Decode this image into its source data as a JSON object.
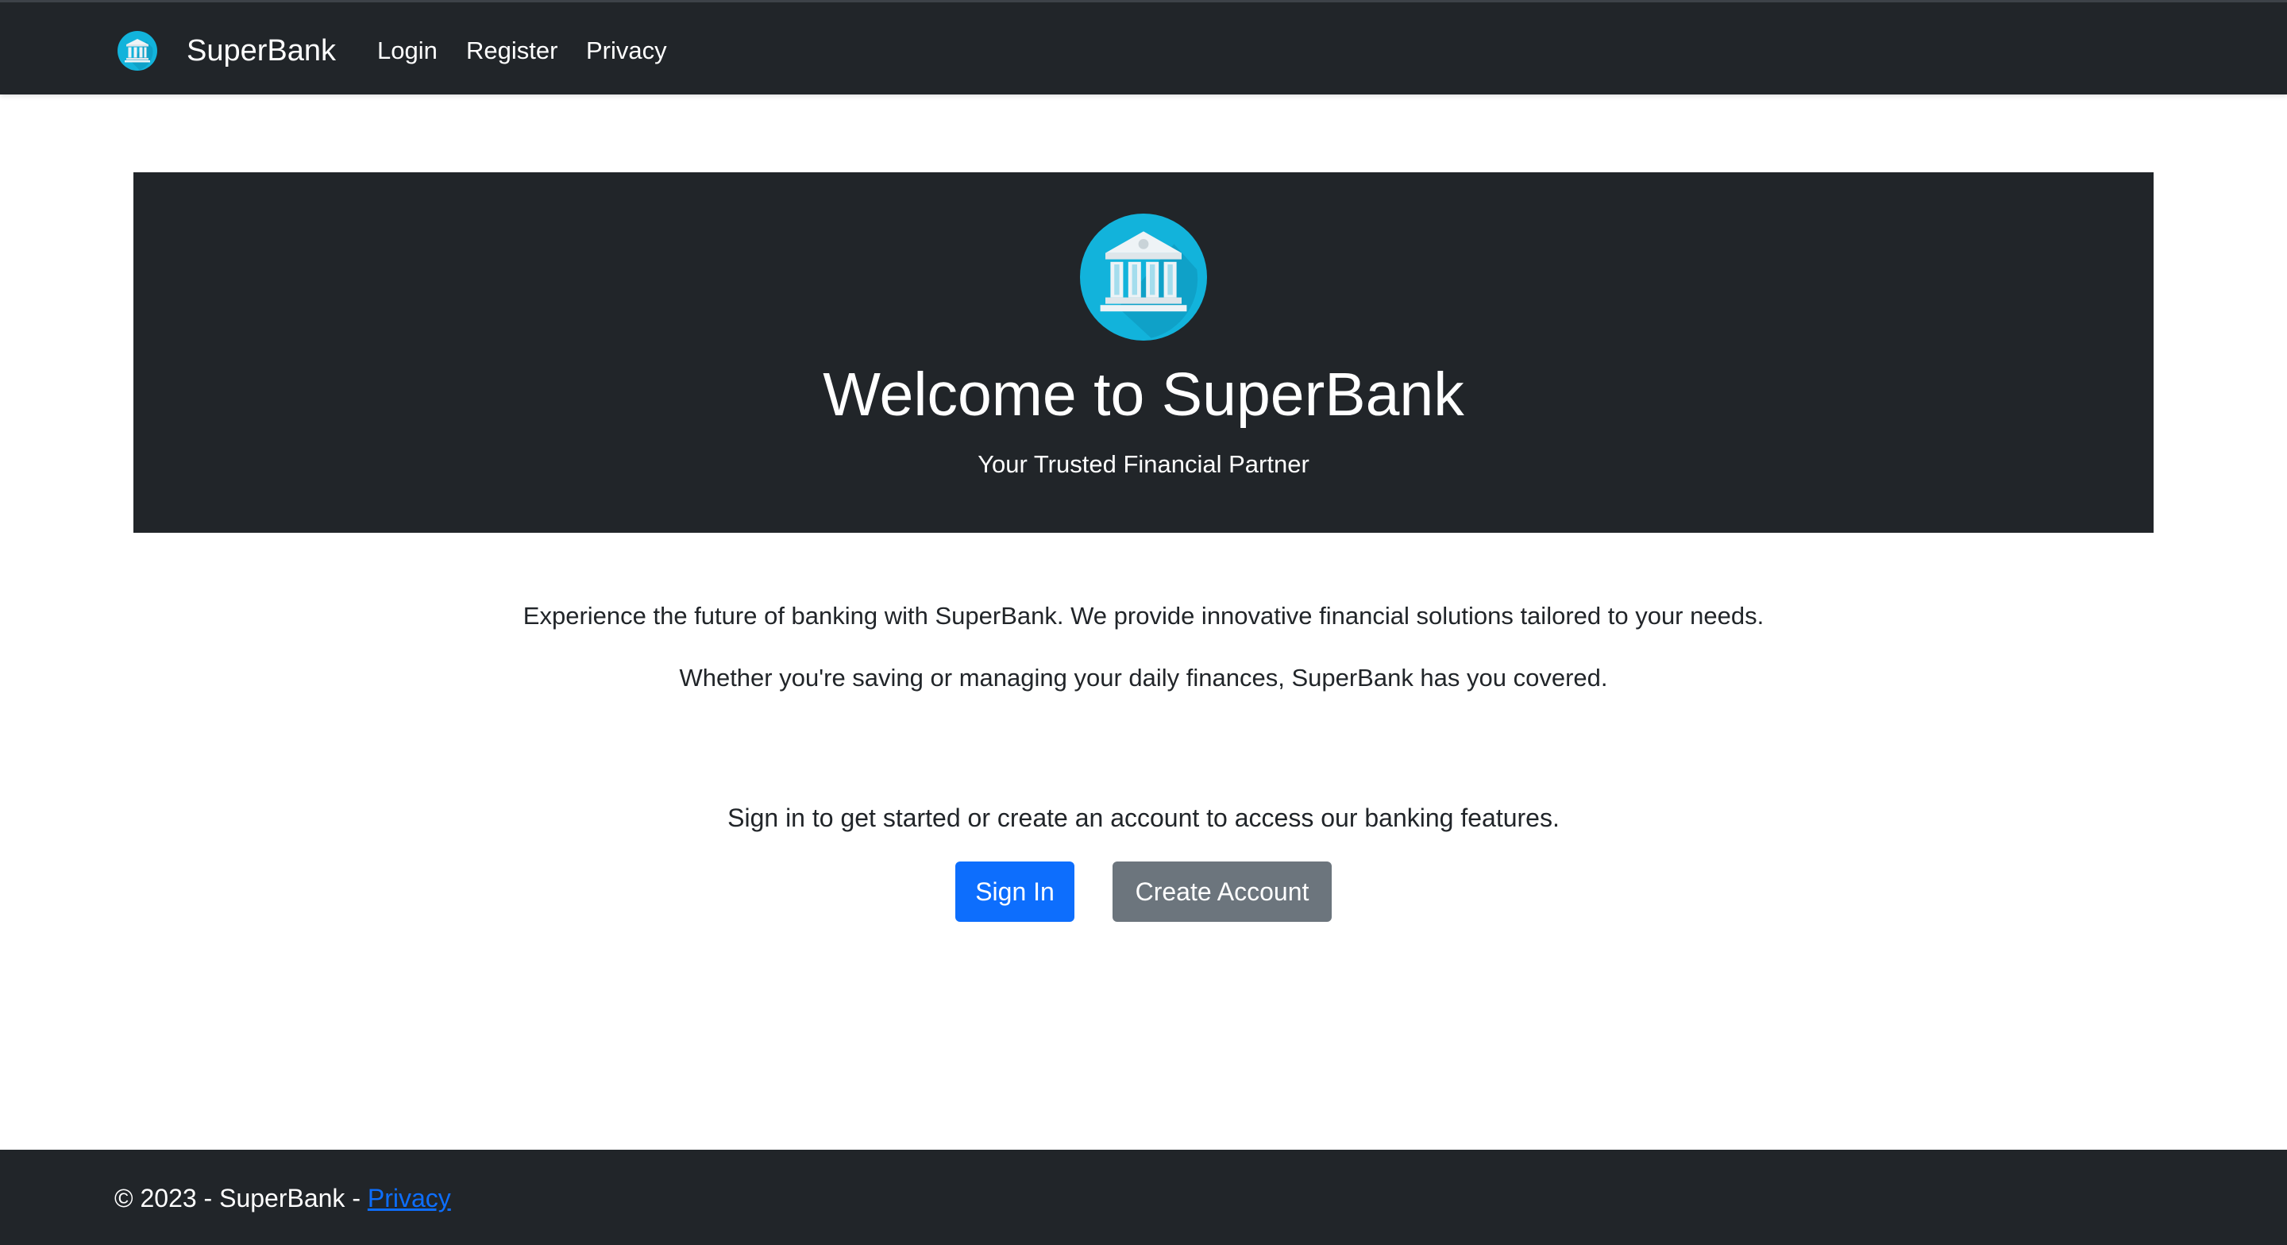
{
  "navbar": {
    "brand": "SuperBank",
    "brand_icon": "bank-building-icon",
    "links": {
      "login": "Login",
      "register": "Register",
      "privacy": "Privacy"
    }
  },
  "hero": {
    "icon": "bank-building-icon",
    "title": "Welcome to SuperBank",
    "subtitle": "Your Trusted Financial Partner"
  },
  "content": {
    "paragraph_1": "Experience the future of banking with SuperBank. We provide innovative financial solutions tailored to your needs.",
    "paragraph_2": "Whether you're saving or managing your daily finances, SuperBank has you covered.",
    "cta_text": "Sign in to get started or create an account to access our banking features.",
    "sign_in_label": "Sign In",
    "create_account_label": "Create Account"
  },
  "footer": {
    "text": "© 2023 - SuperBank - ",
    "privacy_label": "Privacy"
  },
  "colors": {
    "dark": "#212529",
    "primary": "#0d6efd",
    "secondary": "#6c757d",
    "icon_circle": "#1bb4dc",
    "icon_building": "#e8eef2"
  }
}
